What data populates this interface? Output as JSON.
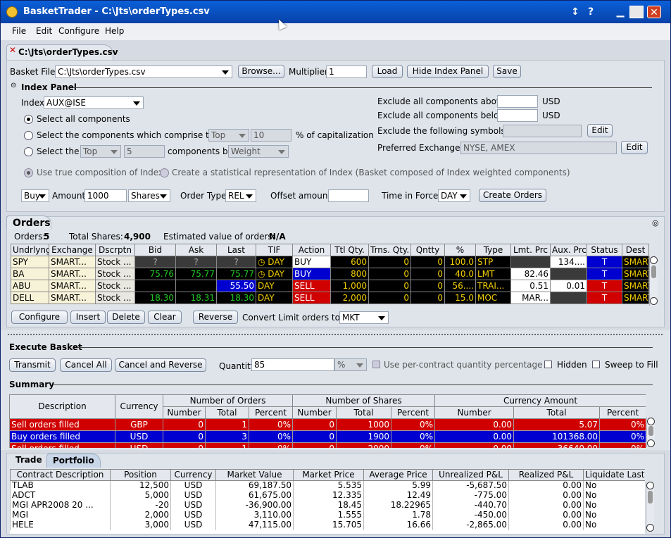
{
  "window": {
    "title": "BasketTrader - C:\\Jts\\orderTypes.csv",
    "pin_icon": "pin-icon",
    "help_icon": "help-icon"
  },
  "menu": [
    "File",
    "Edit",
    "Configure",
    "Help"
  ],
  "doc_tab": {
    "label": "C:\\Jts\\orderTypes.csv"
  },
  "basket": {
    "file_label": "Basket File",
    "file_value": "C:\\Jts\\orderTypes.csv",
    "browse": "Browse...",
    "multiplier_label": "Multiplier",
    "multiplier_value": "1",
    "load": "Load",
    "hide_index": "Hide Index Panel",
    "save": "Save"
  },
  "index_panel": {
    "title": "Index Panel",
    "index_label": "Index",
    "index_value": "AUX@ISE",
    "opt_all": "Select all components",
    "opt_comprise": "Select the components which comprise the",
    "comprise_sel": "Top",
    "comprise_val": "10",
    "comprise_suffix": "% of capitalization",
    "opt_select": "Select the",
    "select_sel": "Top",
    "select_val": "5",
    "select_mid": "components by",
    "select_by": "Weight",
    "excl_above": "Exclude all components above",
    "excl_below": "Exclude all components below",
    "usd": "USD",
    "excl_symbols": "Exclude the following symbols...",
    "edit": "Edit",
    "pref_ex": "Preferred Exchanges",
    "pref_ex_value": "NYSE, AMEX",
    "true_comp": "Use true composition of Index",
    "stat_rep": "Create a statistical representation of Index (Basket composed of Index weighted components)",
    "side": "Buy",
    "amount_label": "Amount",
    "amount_value": "1000",
    "unit": "Shares",
    "ordertype_label": "Order Type",
    "ordertype_value": "REL",
    "offset_label": "Offset amount",
    "tif_label": "Time in Force",
    "tif_value": "DAY",
    "create": "Create Orders"
  },
  "orders": {
    "title": "Orders",
    "count_label": "Orders:",
    "count": "5",
    "shares_label": "Total Shares:",
    "shares": "4,900",
    "est_label": "Estimated value of orders:",
    "est": "N/A",
    "columns": [
      "Undrlyng",
      "Exchange",
      "Dscrptn",
      "Bid",
      "Ask",
      "Last",
      "TIF",
      "Action",
      "Ttl Qty.",
      "Trns. Qty.",
      "Qntty",
      "%",
      "Type",
      "Lmt. Prc",
      "Aux. Prc",
      "Status",
      "Dest"
    ],
    "rows": [
      {
        "sym": "SPY",
        "exch": "SMART...",
        "desc": "Stock ...",
        "bid": "?",
        "ask": "?",
        "last": "?",
        "tif": "DAY",
        "action": "BUY",
        "ttl": "600",
        "trns": "0",
        "qty": "0",
        "pct": "100.0",
        "type": "STP",
        "lmt": "",
        "aux": "134....",
        "status": "T",
        "dest": "SMART"
      },
      {
        "sym": "BA",
        "exch": "SMART...",
        "desc": "Stock ...",
        "bid": "75.76",
        "ask": "75.77",
        "last": "75.77",
        "tif": "DAY",
        "action": "BUY",
        "ttl": "800",
        "trns": "0",
        "qty": "0",
        "pct": "40.0",
        "type": "LMT",
        "lmt": "82.46",
        "aux": "",
        "status": "T",
        "dest": "SMART"
      },
      {
        "sym": "ABU",
        "exch": "SMART...",
        "desc": "Stock ...",
        "bid": "",
        "ask": "",
        "last": "55.50",
        "tif": "DAY",
        "action": "SELL",
        "ttl": "1,000",
        "trns": "0",
        "qty": "0",
        "pct": "56....",
        "type": "TRAI...",
        "lmt": "0.51",
        "aux": "0.01",
        "status": "T",
        "dest": "SMART"
      },
      {
        "sym": "DELL",
        "exch": "SMART...",
        "desc": "Stock ...",
        "bid": "18.30",
        "ask": "18.31",
        "last": "18.30",
        "tif": "DAY",
        "action": "SELL",
        "ttl": "2,000",
        "trns": "0",
        "qty": "0",
        "pct": "15.0",
        "type": "MOC",
        "lmt": "MAR...",
        "aux": "",
        "status": "T",
        "dest": "SMART"
      }
    ],
    "buttons": {
      "configure": "Configure",
      "insert": "Insert",
      "delete": "Delete",
      "clear": "Clear",
      "reverse": "Reverse"
    },
    "convert_label": "Convert Limit orders to...",
    "convert_value": "MKT"
  },
  "execute": {
    "title": "Execute Basket",
    "transmit": "Transmit",
    "cancel_all": "Cancel All",
    "cancel_reverse": "Cancel and Reverse",
    "qty_label": "Quantity",
    "qty_value": "85",
    "qty_unit": "%",
    "per_contract": "Use per-contract quantity percentage",
    "hidden": "Hidden",
    "sweep": "Sweep to Fill"
  },
  "summary": {
    "title": "Summary",
    "groups": [
      "Description",
      "Currency",
      "Number of Orders",
      "Number of Shares",
      "Currency Amount"
    ],
    "sub": [
      "Number",
      "Total",
      "Percent",
      "Number",
      "Total",
      "Percent",
      "Number",
      "Total",
      "Percent"
    ],
    "rows": [
      {
        "desc": "Sell orders filled",
        "cur": "GBP",
        "on": "0",
        "ot": "1",
        "op": "0%",
        "sn": "0",
        "st": "1000",
        "sp": "0%",
        "cn": "0.00",
        "ct": "5.07",
        "cp": "0%"
      },
      {
        "desc": "Buy orders filled",
        "cur": "USD",
        "on": "0",
        "ot": "3",
        "op": "0%",
        "sn": "0",
        "st": "1900",
        "sp": "0%",
        "cn": "0.00",
        "ct": "101368.00",
        "cp": "0%"
      },
      {
        "desc": "Sell orders filled",
        "cur": "USD",
        "on": "0",
        "ot": "1",
        "op": "0%",
        "sn": "0",
        "st": "2000",
        "sp": "0%",
        "cn": "0.00",
        "ct": "36640.00",
        "cp": "0%"
      }
    ]
  },
  "portfolio": {
    "tabs": [
      "Trade",
      "Portfolio"
    ],
    "columns": [
      "Contract Description",
      "Position",
      "Currency",
      "Market Value",
      "Market Price",
      "Average Price",
      "Unrealized P&L",
      "Realized P&L",
      "Liquidate Last"
    ],
    "rows": [
      [
        "TLAB",
        "12,500",
        "USD",
        "69,187.50",
        "5.535",
        "5.99",
        "-5,687.50",
        "0.00",
        "No"
      ],
      [
        "ADCT",
        "5,000",
        "USD",
        "61,675.00",
        "12.335",
        "12.49",
        "-775.00",
        "0.00",
        "No"
      ],
      [
        "MGI    APR2008 20 ...",
        "-20",
        "USD",
        "-36,900.00",
        "18.45",
        "18.22965",
        "-440.70",
        "0.00",
        "No"
      ],
      [
        "MGI",
        "2,000",
        "USD",
        "3,110.00",
        "1.555",
        "1.78",
        "-450.00",
        "0.00",
        "No"
      ],
      [
        "HELE",
        "3,000",
        "USD",
        "47,115.00",
        "15.705",
        "16.66",
        "-2,865.00",
        "0.00",
        "No"
      ]
    ]
  },
  "colors": {
    "title_bar": "#0842a8",
    "buy": "#0000d0",
    "sell": "#d00000",
    "grid_bg": "#000000",
    "grid_text": "#f4d000"
  }
}
